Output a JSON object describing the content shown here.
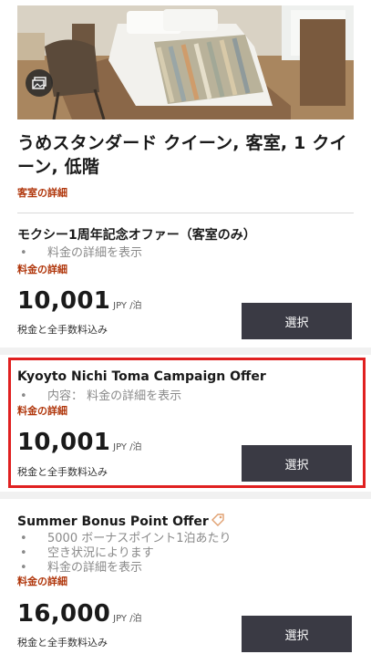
{
  "room": {
    "title": "うめスタンダード クイーン, 客室, 1 クイーン, 低階",
    "detail_link": "客室の詳細"
  },
  "offers": [
    {
      "title": "モクシー1周年記念オファー（客室のみ）",
      "bullets": [
        "料金の詳細を表示"
      ],
      "detail_link": "料金の詳細",
      "price": "10,001",
      "unit": "JPY /泊",
      "tax": "税金と全手数料込み",
      "select": "選択"
    },
    {
      "title": "Kyoyto Nichi Toma Campaign Offer",
      "bullets": [
        "内容：  料金の詳細を表示"
      ],
      "detail_link": "料金の詳細",
      "price": "10,001",
      "unit": "JPY /泊",
      "tax": "税金と全手数料込み",
      "select": "選択"
    },
    {
      "title": "Summer Bonus Point Offer",
      "bullets": [
        "5000 ボーナスポイント1泊あたり",
        "空き状況によります",
        "料金の詳細を表示"
      ],
      "detail_link": "料金の詳細",
      "price": "16,000",
      "unit": "JPY /泊",
      "tax": "税金と全手数料込み",
      "select": "選択"
    }
  ],
  "colors": {
    "link": "#b0360b",
    "button": "#3a3a44",
    "highlight": "#e02020"
  },
  "icons": {
    "gallery": "image-gallery-icon",
    "tag": "price-tag-icon"
  }
}
